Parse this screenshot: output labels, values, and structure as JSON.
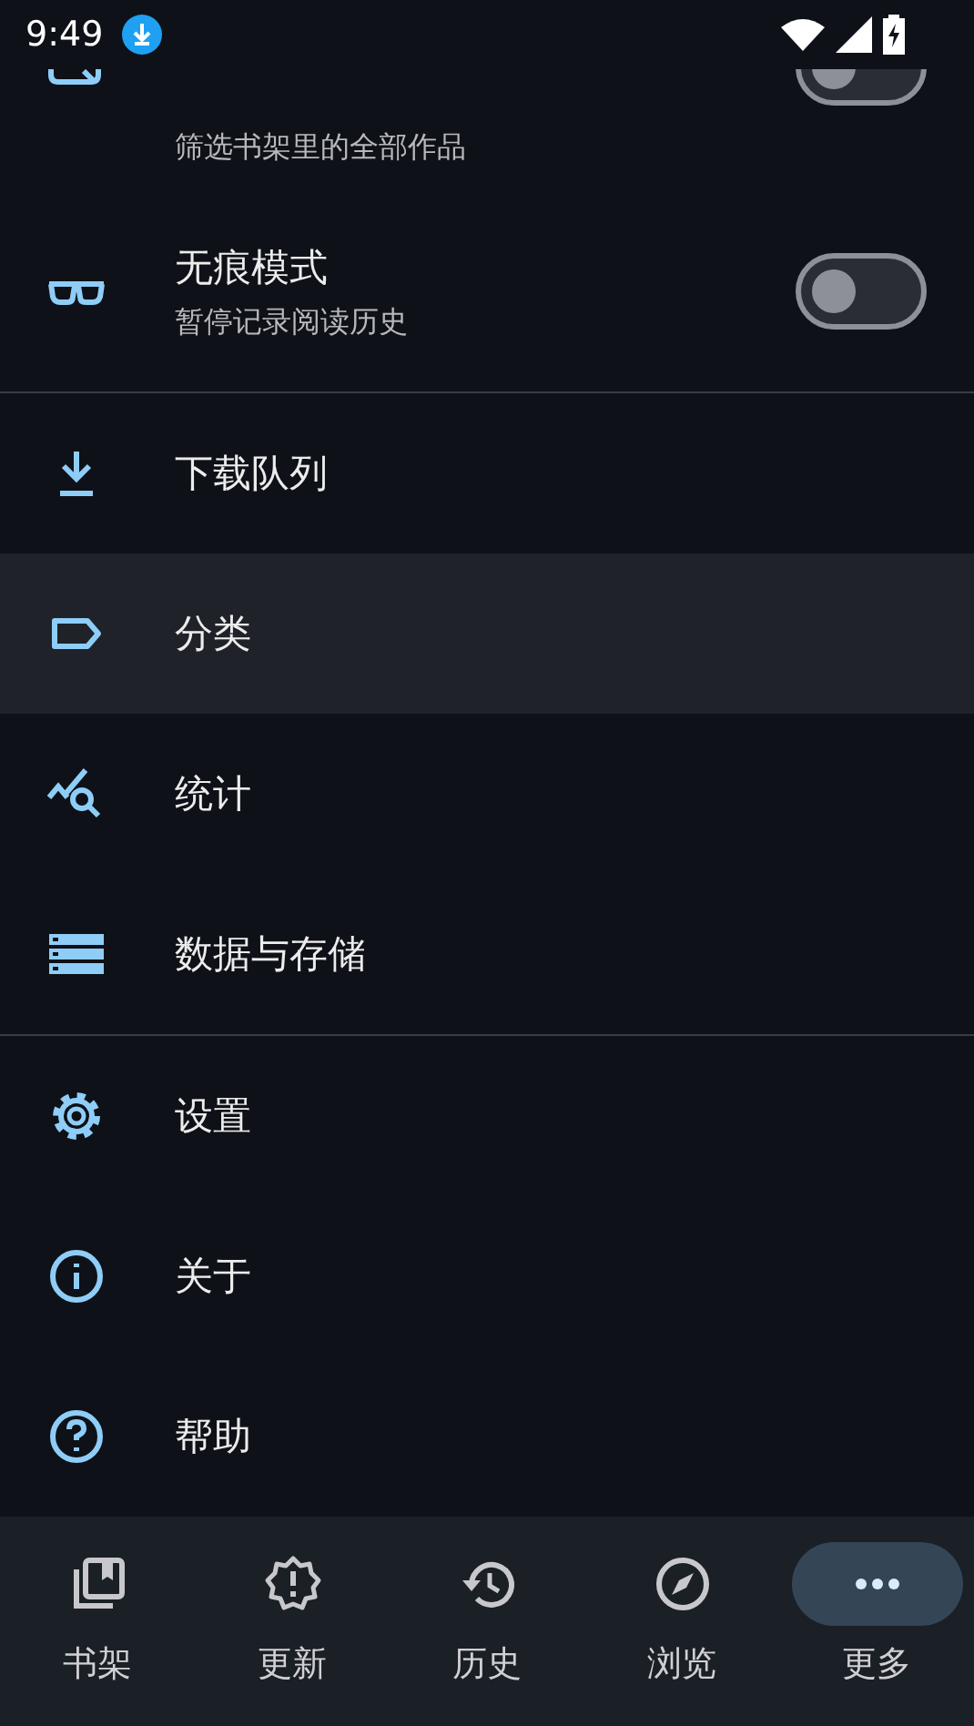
{
  "status_bar": {
    "time": "9:49"
  },
  "toggles": [
    {
      "kind": "filter",
      "subtitle": "筛选书架里的全部作品",
      "on": false,
      "partial": true
    },
    {
      "kind": "glasses",
      "title": "无痕模式",
      "subtitle": "暂停记录阅读历史",
      "on": false
    }
  ],
  "menu_groups": [
    [
      {
        "kind": "download",
        "label": "下载队列",
        "selected": false
      },
      {
        "kind": "label",
        "label": "分类",
        "selected": true
      },
      {
        "kind": "stats",
        "label": "统计",
        "selected": false
      },
      {
        "kind": "storage",
        "label": "数据与存储",
        "selected": false
      }
    ],
    [
      {
        "kind": "settings",
        "label": "设置",
        "selected": false
      },
      {
        "kind": "info",
        "label": "关于",
        "selected": false
      },
      {
        "kind": "help",
        "label": "帮助",
        "selected": false
      }
    ]
  ],
  "bottom_nav": [
    {
      "kind": "library",
      "label": "书架",
      "selected": false
    },
    {
      "kind": "updates",
      "label": "更新",
      "selected": false
    },
    {
      "kind": "history",
      "label": "历史",
      "selected": false
    },
    {
      "kind": "browse",
      "label": "浏览",
      "selected": false
    },
    {
      "kind": "more",
      "label": "更多",
      "selected": true
    }
  ]
}
